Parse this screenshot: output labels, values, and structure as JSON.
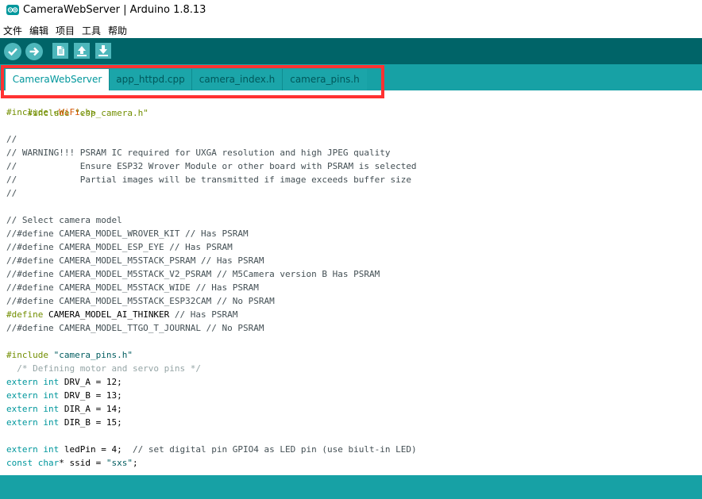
{
  "window": {
    "title": "CameraWebServer | Arduino 1.8.13",
    "icon": "arduino-logo-icon"
  },
  "menu": [
    "文件",
    "编辑",
    "项目",
    "工具",
    "帮助"
  ],
  "toolbar": {
    "buttons": [
      {
        "name": "verify-icon",
        "icon": "check"
      },
      {
        "name": "upload-icon",
        "icon": "arrow-right"
      },
      {
        "name": "new-icon",
        "icon": "page"
      },
      {
        "name": "open-icon",
        "icon": "arrow-up"
      },
      {
        "name": "save-icon",
        "icon": "arrow-down"
      }
    ]
  },
  "tabs": [
    {
      "label": "CameraWebServer",
      "active": true
    },
    {
      "label": "app_httpd.cpp",
      "active": false
    },
    {
      "label": "camera_index.h",
      "active": false
    },
    {
      "label": "camera_pins.h",
      "active": false
    }
  ],
  "editor": {
    "partial_first_line": "#include \"esp_camera.h\"",
    "lines": [
      [
        {
          "t": "#include <",
          "c": "pre"
        },
        {
          "t": "WiFi",
          "c": "lib"
        },
        {
          "t": ".h>",
          "c": "pre"
        }
      ],
      [],
      [
        {
          "t": "//",
          "c": "comment"
        }
      ],
      [
        {
          "t": "// WARNING!!! PSRAM IC required for UXGA resolution and high JPEG quality",
          "c": "comment"
        }
      ],
      [
        {
          "t": "//            Ensure ESP32 Wrover Module or other board with PSRAM is selected",
          "c": "comment"
        }
      ],
      [
        {
          "t": "//            Partial images will be transmitted if image exceeds buffer size",
          "c": "comment"
        }
      ],
      [
        {
          "t": "//",
          "c": "comment"
        }
      ],
      [],
      [
        {
          "t": "// Select camera model",
          "c": "comment"
        }
      ],
      [
        {
          "t": "//#define CAMERA_MODEL_WROVER_KIT // Has PSRAM",
          "c": "comment"
        }
      ],
      [
        {
          "t": "//#define CAMERA_MODEL_ESP_EYE // Has PSRAM",
          "c": "comment"
        }
      ],
      [
        {
          "t": "//#define CAMERA_MODEL_M5STACK_PSRAM // Has PSRAM",
          "c": "comment"
        }
      ],
      [
        {
          "t": "//#define CAMERA_MODEL_M5STACK_V2_PSRAM // M5Camera version B Has PSRAM",
          "c": "comment"
        }
      ],
      [
        {
          "t": "//#define CAMERA_MODEL_M5STACK_WIDE // Has PSRAM",
          "c": "comment"
        }
      ],
      [
        {
          "t": "//#define CAMERA_MODEL_M5STACK_ESP32CAM // No PSRAM",
          "c": "comment"
        }
      ],
      [
        {
          "t": "#define ",
          "c": "pre"
        },
        {
          "t": "CAMERA_MODEL_AI_THINKER",
          "c": "macro"
        },
        {
          "t": " // Has PSRAM",
          "c": "comment"
        }
      ],
      [
        {
          "t": "//#define CAMERA_MODEL_TTGO_T_JOURNAL // No PSRAM",
          "c": "comment"
        }
      ],
      [],
      [
        {
          "t": "#include ",
          "c": "pre"
        },
        {
          "t": "\"camera_pins.h\"",
          "c": "str"
        }
      ],
      [
        {
          "t": "  /* Defining motor and servo pins */",
          "c": "dim"
        }
      ],
      [
        {
          "t": "extern ",
          "c": "type"
        },
        {
          "t": "int",
          "c": "type"
        },
        {
          "t": " DRV_A = 12;",
          "c": "macro"
        }
      ],
      [
        {
          "t": "extern ",
          "c": "type"
        },
        {
          "t": "int",
          "c": "type"
        },
        {
          "t": " DRV_B = 13;",
          "c": "macro"
        }
      ],
      [
        {
          "t": "extern ",
          "c": "type"
        },
        {
          "t": "int",
          "c": "type"
        },
        {
          "t": " DIR_A = 14;",
          "c": "macro"
        }
      ],
      [
        {
          "t": "extern ",
          "c": "type"
        },
        {
          "t": "int",
          "c": "type"
        },
        {
          "t": " DIR_B = 15;",
          "c": "macro"
        }
      ],
      [],
      [
        {
          "t": "extern ",
          "c": "type"
        },
        {
          "t": "int",
          "c": "type"
        },
        {
          "t": " ledPin = 4;  ",
          "c": "macro"
        },
        {
          "t": "// set digital pin GPIO4 as LED pin (use biult-in LED)",
          "c": "comment"
        }
      ],
      [
        {
          "t": "const ",
          "c": "type"
        },
        {
          "t": "char",
          "c": "type"
        },
        {
          "t": "* ssid = ",
          "c": "macro"
        },
        {
          "t": "\"sxs\"",
          "c": "str"
        },
        {
          "t": ";",
          "c": "macro"
        }
      ]
    ]
  },
  "colors": {
    "toolbar": "#006468",
    "tabbar": "#17a1a5",
    "highlight": "#ff3232",
    "active_tab_text": "#00979c"
  }
}
